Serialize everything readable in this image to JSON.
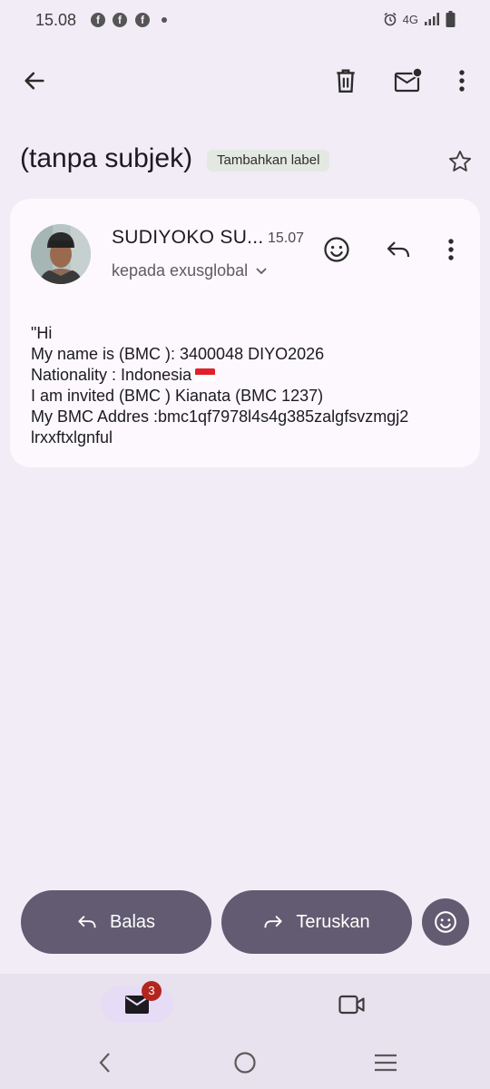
{
  "status_bar": {
    "time": "15.08",
    "app_icon": "f",
    "network": "4G"
  },
  "app_bar": {
    "back_icon": "arrow-left-icon",
    "delete_icon": "trash-icon",
    "mark_unread_icon": "mail-unread-icon",
    "more_icon": "more-vert-icon"
  },
  "email": {
    "subject": "(tanpa subjek)",
    "label_chip": "Tambahkan label",
    "sender": "SUDIYOKO SU...",
    "time": "15.07",
    "recipient": "kepada exusglobal",
    "body_lines": [
      "\"Hi",
      "My name is (BMC ): 3400048 DIYO2026",
      "Nationality : Indonesia",
      "I am invited (BMC ) Kianata (BMC 1237)",
      "My BMC Addres :bmc1qf7978l4s4g385zalgfsvzmgj2",
      "lrxxftxlgnful"
    ]
  },
  "actions": {
    "reply_label": "Balas",
    "forward_label": "Teruskan"
  },
  "bottom_nav": {
    "mail_badge": "3"
  },
  "colors": {
    "background": "#f1ecf6",
    "card": "#fcf8fd",
    "action_button": "#625b71",
    "badge": "#b3261e"
  }
}
